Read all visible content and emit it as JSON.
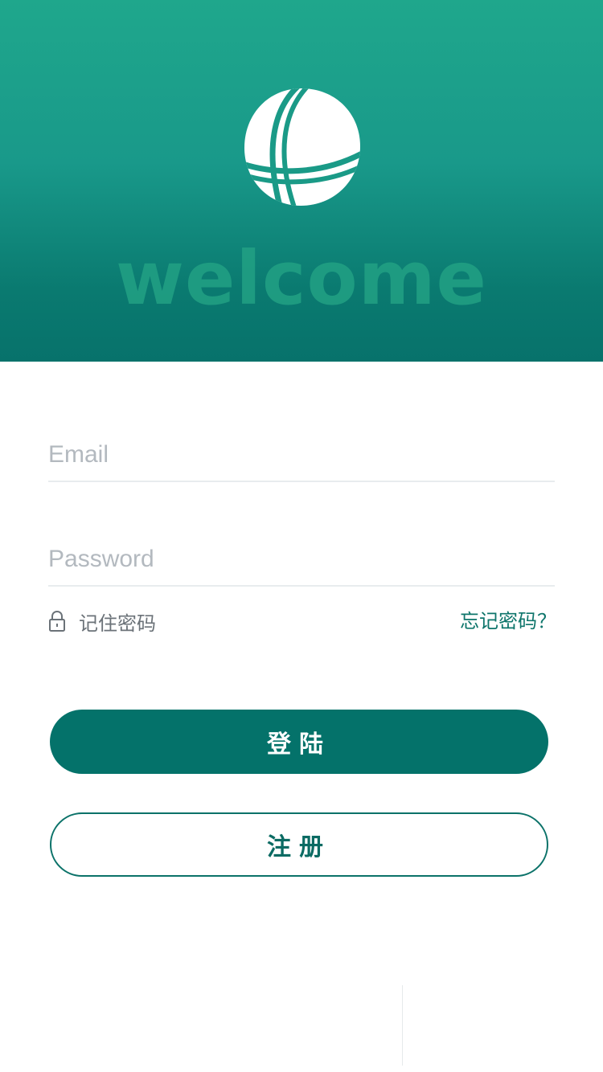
{
  "hero": {
    "welcome_text": "welcome",
    "logo_icon": "globe-logo-icon",
    "gradient_top": "#1fa78c",
    "gradient_bottom": "#07726b"
  },
  "form": {
    "email_placeholder": "Email",
    "email_value": "",
    "password_placeholder": "Password",
    "password_value": "",
    "remember_icon": "lock-icon",
    "remember_label": "记住密码",
    "forgot_label": "忘记密码？"
  },
  "actions": {
    "login_label": "登陆",
    "register_label": "注册",
    "accent_color": "#04726a"
  }
}
